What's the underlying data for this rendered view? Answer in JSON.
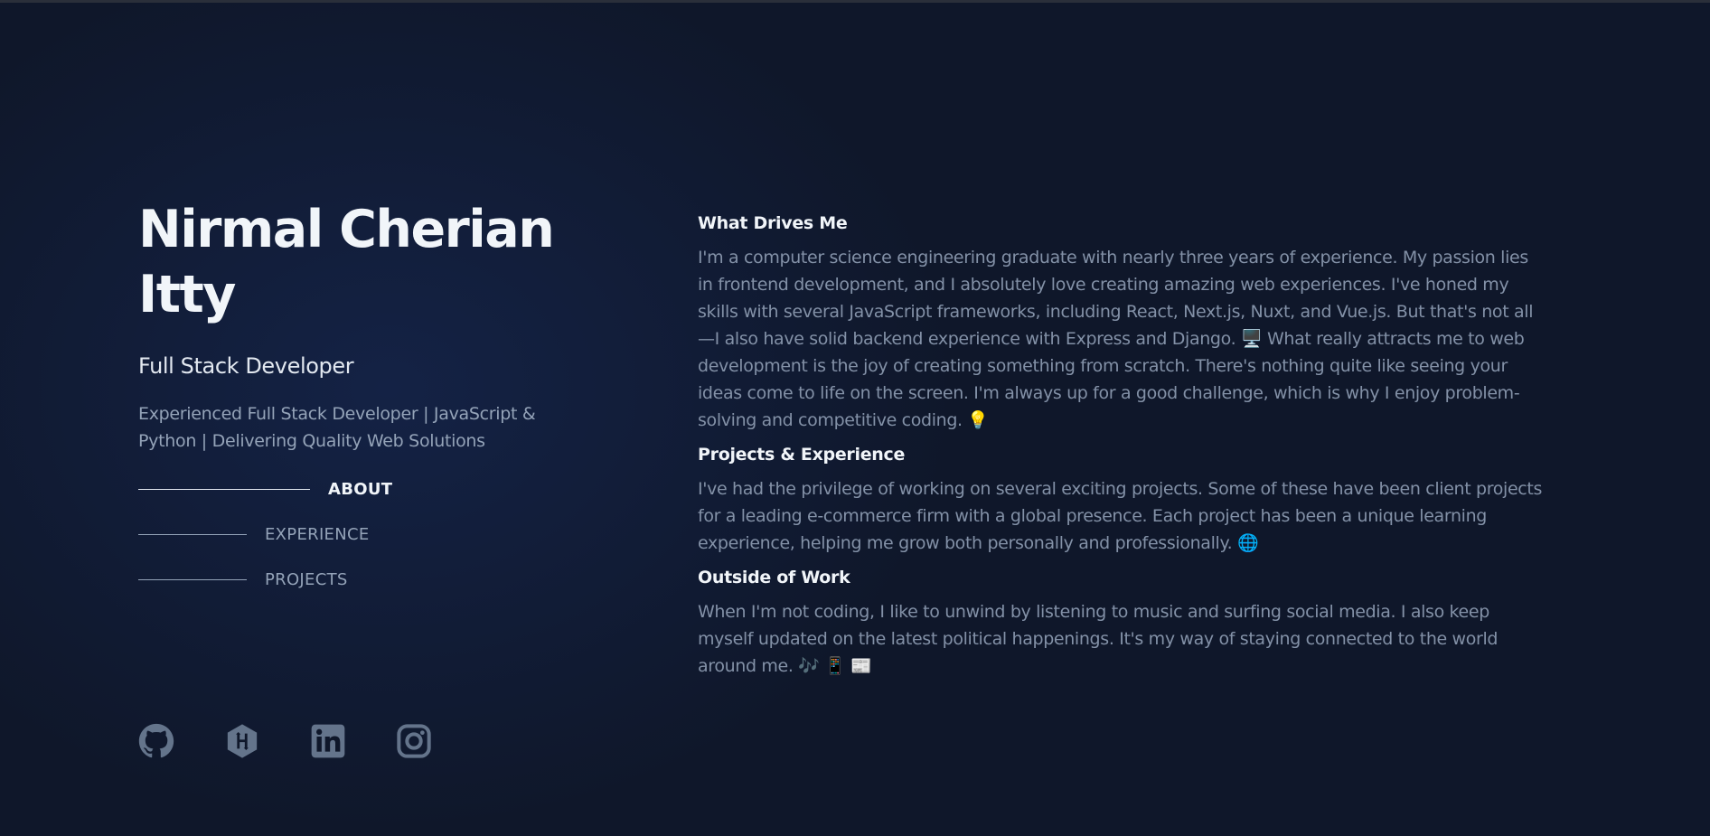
{
  "profile": {
    "name": "Nirmal Cherian Itty",
    "role": "Full Stack Developer",
    "tagline": "Experienced Full Stack Developer | JavaScript & Python | Delivering Quality Web Solutions"
  },
  "nav": {
    "items": [
      {
        "label": "ABOUT",
        "active": true
      },
      {
        "label": "EXPERIENCE",
        "active": false
      },
      {
        "label": "PROJECTS",
        "active": false
      }
    ]
  },
  "socials": [
    {
      "name": "github-icon"
    },
    {
      "name": "hackerrank-icon"
    },
    {
      "name": "linkedin-icon"
    },
    {
      "name": "instagram-icon"
    }
  ],
  "about": {
    "sections": [
      {
        "title": "What Drives Me",
        "text": "I'm a computer science engineering graduate with nearly three years of experience. My passion lies in frontend development, and I absolutely love creating amazing web experiences. I've honed my skills with several JavaScript frameworks, including React, Next.js, Nuxt, and Vue.js. But that's not all—I also have solid backend experience with Express and Django. 🖥️ What really attracts me to web development is the joy of creating something from scratch. There's nothing quite like seeing your ideas come to life on the screen. I'm always up for a good challenge, which is why I enjoy problem-solving and competitive coding. 💡"
      },
      {
        "title": "Projects & Experience",
        "text": "I've had the privilege of working on several exciting projects. Some of these have been client projects for a leading e-commerce firm with a global presence. Each project has been a unique learning experience, helping me grow both personally and professionally. 🌐"
      },
      {
        "title": "Outside of Work",
        "text": "When I'm not coding, I like to unwind by listening to music and surfing social media. I also keep myself updated on the latest political happenings. It's my way of staying connected to the world around me. 🎶 📱 📰"
      }
    ]
  },
  "colors": {
    "background": "#0f172a",
    "heading": "#f1f5f9",
    "muted": "#94a3b8",
    "icon": "#64748b"
  }
}
